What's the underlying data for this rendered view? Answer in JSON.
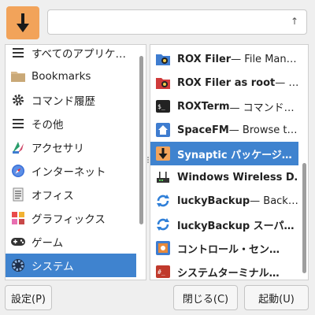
{
  "search": {
    "value": "",
    "placeholder": "",
    "up_glyph": "↑"
  },
  "categories": [
    {
      "label": "すべてのアプリケ…",
      "icon": "list-icon"
    },
    {
      "label": "Bookmarks",
      "icon": "folder-icon"
    },
    {
      "label": "コマンド履歴",
      "icon": "gear-icon"
    },
    {
      "label": "その他",
      "icon": "list-icon"
    },
    {
      "label": "アクセサリ",
      "icon": "accessories-icon"
    },
    {
      "label": "インターネット",
      "icon": "compass-icon"
    },
    {
      "label": "オフィス",
      "icon": "document-icon"
    },
    {
      "label": "グラフィックス",
      "icon": "palette-icon"
    },
    {
      "label": "ゲーム",
      "icon": "gamepad-icon"
    },
    {
      "label": "システム",
      "icon": "system-gear-icon",
      "selected": true
    }
  ],
  "apps": [
    {
      "name": "ROX Filer",
      "desc": " — File Man…",
      "icon": "rox-filer-icon"
    },
    {
      "name": "ROX Filer as root",
      "desc": " — …",
      "icon": "rox-filer-root-icon"
    },
    {
      "name": "ROXTerm",
      "desc": " — コマンド…",
      "icon": "terminal-icon"
    },
    {
      "name": "SpaceFM",
      "desc": " — Browse t…",
      "icon": "home-icon"
    },
    {
      "name": "Synaptic パッケージ…",
      "desc": "",
      "icon": "synaptic-icon",
      "selected": true
    },
    {
      "name": "Windows Wireless D…",
      "desc": "",
      "icon": "router-icon"
    },
    {
      "name": "luckyBackup",
      "desc": " — Back…",
      "icon": "sync-icon"
    },
    {
      "name": "luckyBackup スーパ…",
      "desc": "",
      "icon": "sync-icon"
    },
    {
      "name": "コントロール・セン…",
      "desc": "",
      "icon": "control-center-icon"
    },
    {
      "name": "システムターミナル…",
      "desc": "",
      "icon": "terminal-icon"
    }
  ],
  "buttons": {
    "settings": "設定(P)",
    "close": "閉じる(C)",
    "launch": "起動(U)"
  },
  "colors": {
    "selection": "#3f83cf",
    "app_icon": "#f2a35a"
  }
}
